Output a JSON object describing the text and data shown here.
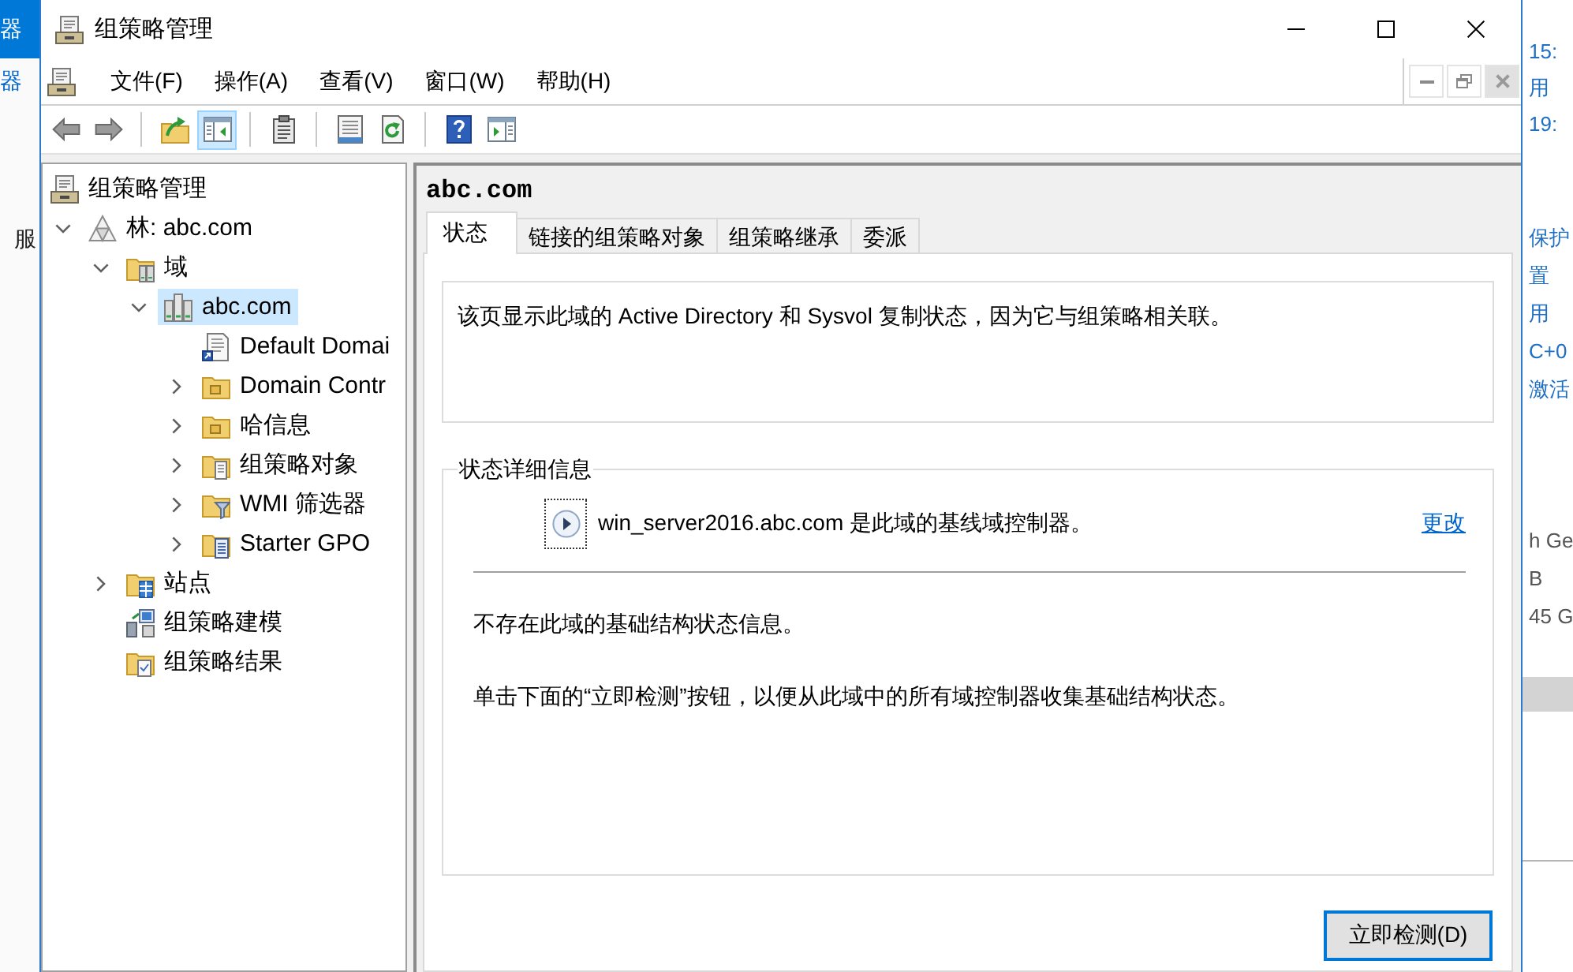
{
  "background_left": [
    {
      "text": "器",
      "kind": "highlight"
    },
    {
      "text": "器",
      "kind": "link"
    },
    {
      "text": "服",
      "kind": "plain"
    }
  ],
  "window": {
    "title": "组策略管理"
  },
  "menu_bar": [
    "文件(F)",
    "操作(A)",
    "查看(V)",
    "窗口(W)",
    "帮助(H)"
  ],
  "toolbar": [
    [
      {
        "kind": "back",
        "pressed": false
      },
      {
        "kind": "forward",
        "pressed": false
      }
    ],
    [
      {
        "kind": "up",
        "pressed": false
      },
      {
        "kind": "tree",
        "pressed": true
      }
    ],
    [
      {
        "kind": "properties",
        "pressed": false
      }
    ],
    [
      {
        "kind": "export",
        "pressed": false
      },
      {
        "kind": "refresh",
        "pressed": false
      }
    ],
    [
      {
        "kind": "help",
        "pressed": false
      },
      {
        "kind": "actions",
        "pressed": false
      }
    ]
  ],
  "console_tree": [
    {
      "label": "组策略管理",
      "kind": "console",
      "selected": false,
      "children": [
        {
          "label": "林: abc.com",
          "kind": "forest",
          "expanded": true,
          "selected": false,
          "children": [
            {
              "label": "域",
              "kind": "domains",
              "expanded": true,
              "selected": false,
              "children": [
                {
                  "label": "abc.com",
                  "kind": "domain",
                  "expanded": true,
                  "selected": true,
                  "children": [
                    {
                      "label": "Default Domai",
                      "kind": "link",
                      "selected": false
                    },
                    {
                      "label": "Domain Contr",
                      "kind": "unit",
                      "expanded": false,
                      "selected": false
                    },
                    {
                      "label": "哈信息",
                      "kind": "unit",
                      "expanded": false,
                      "selected": false
                    },
                    {
                      "label": "组策略对象",
                      "kind": "objects",
                      "expanded": false,
                      "selected": false
                    },
                    {
                      "label": "WMI 筛选器",
                      "kind": "filters",
                      "expanded": false,
                      "selected": false
                    },
                    {
                      "label": "Starter GPO",
                      "kind": "starters",
                      "expanded": false,
                      "selected": false
                    }
                  ]
                }
              ]
            },
            {
              "label": "站点",
              "kind": "sites",
              "expanded": false,
              "selected": false
            },
            {
              "label": "组策略建模",
              "kind": "modeling",
              "selected": false
            },
            {
              "label": "组策略结果",
              "kind": "results",
              "selected": false
            }
          ]
        }
      ]
    }
  ],
  "details": {
    "title": "abc.com",
    "tabs": [
      {
        "label": "状态",
        "selected": true
      },
      {
        "label": "链接的组策略对象",
        "selected": false
      },
      {
        "label": "组策略继承",
        "selected": false
      },
      {
        "label": "委派",
        "selected": false
      }
    ],
    "description": "该页显示此域的 Active Directory 和 Sysvol 复制状态，因为它与组策略相关联。",
    "status_details": {
      "legend": "状态详细信息",
      "baseline": {
        "expanded": false,
        "text": "win_server2016.abc.com 是此域的基线域控制器。",
        "link": "更改"
      },
      "messages": [
        "不存在此域的基础结构状态信息。",
        "单击下面的“立即检测”按钮，以便从此域中的所有域控制器收集基础结构状态。"
      ]
    },
    "button": "立即检测(D)"
  },
  "background_right": [
    {
      "kind": "link",
      "texts": [
        "15:",
        "用",
        "19:"
      ]
    },
    {
      "kind": "link",
      "texts": [
        "保护",
        "置",
        "用",
        "C+0",
        "激活"
      ]
    },
    {
      "kind": "plain",
      "texts": [
        "h Ge",
        "B",
        "45 G"
      ]
    }
  ]
}
